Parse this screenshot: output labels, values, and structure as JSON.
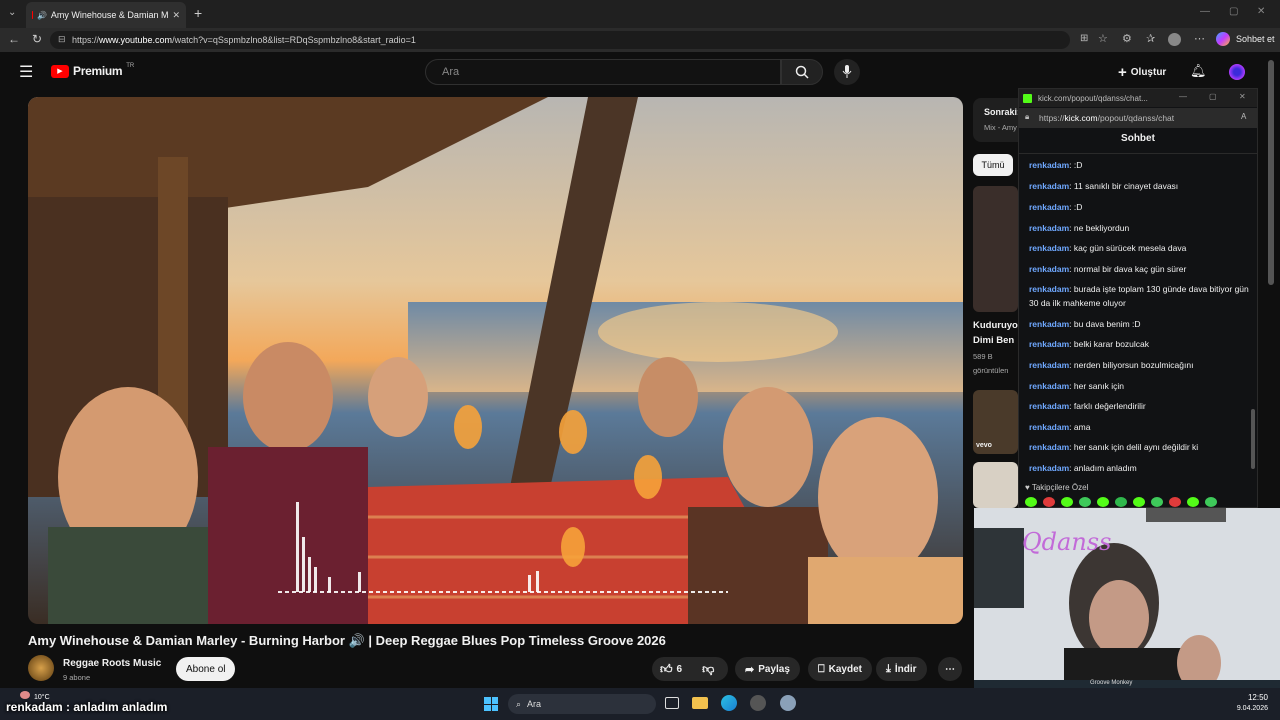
{
  "browser": {
    "tab_title": "Amy Winehouse & Damian M",
    "url_prefix": "https://",
    "url_domain": "www.youtube.com",
    "url_rest": "/watch?v=qSspmbzlno8&list=RDqSspmbzlno8&start_radio=1",
    "copilot_label": "Sohbet et"
  },
  "youtube": {
    "logo_text": "Premium",
    "logo_badge": "TR",
    "search_placeholder": "Ara",
    "create_label": "Oluştur",
    "video_title": "Amy Winehouse & Damian Marley - Burning Harbor 🔊 | Deep Reggae Blues Pop Timeless Groove 2026",
    "channel_name": "Reggae Roots Music",
    "subscribers": "9 abone",
    "subscribe_label": "Abone ol",
    "like_count": "6",
    "share_label": "Paylaş",
    "save_label": "Kaydet",
    "download_label": "İndir",
    "sidebar": {
      "next_label": "Sonraki:",
      "mix_label": "Mix - Amy",
      "all_chip": "Tümü",
      "rec_title_1": "Kuduruyo",
      "rec_title_2": "Dimi Ben",
      "rec_views": "589 B",
      "rec_views_2": "görüntülen",
      "vevo": "vevo"
    }
  },
  "chat": {
    "window_title": "kick.com/popout/qdanss/chat...",
    "url_prefix": "https://",
    "url_domain": "kick.com",
    "url_rest": "/popout/qdanss/chat",
    "header": "Sohbet",
    "followers_only": "Takipçilere Özel",
    "messages": [
      {
        "user": "renkadam",
        "text": ":D"
      },
      {
        "user": "renkadam",
        "text": "11 sanıklı bir cinayet davası"
      },
      {
        "user": "renkadam",
        "text": ":D"
      },
      {
        "user": "renkadam",
        "text": "ne bekliyordun"
      },
      {
        "user": "renkadam",
        "text": "kaç gün sürücek mesela dava"
      },
      {
        "user": "renkadam",
        "text": "normal bir dava kaç gün sürer"
      },
      {
        "user": "renkadam",
        "text": "burada işte toplam 130 günde dava bitiyor gün 30 da ilk mahkeme oluyor"
      },
      {
        "user": "renkadam",
        "text": "bu dava benim :D"
      },
      {
        "user": "renkadam",
        "text": "belki karar bozulcak"
      },
      {
        "user": "renkadam",
        "text": "nerden biliyorsun bozulmicağını"
      },
      {
        "user": "renkadam",
        "text": "her sanık için"
      },
      {
        "user": "renkadam",
        "text": "farklı değerlendirilir"
      },
      {
        "user": "renkadam",
        "text": "ama"
      },
      {
        "user": "renkadam",
        "text": "her sanık için delil aynı değildir ki"
      },
      {
        "user": "renkadam",
        "text": "anladım anladım"
      }
    ]
  },
  "webcam": {
    "watermark": "Qdanss",
    "caption": "Groove Monkey"
  },
  "overlay": {
    "user": "renkadam",
    "text": ": anladım anladım",
    "temperature": "10°C"
  },
  "taskbar": {
    "search_placeholder": "Ara",
    "time": "12:50",
    "date": "9.04.2026"
  },
  "colors": {
    "youtube_red": "#ff0000",
    "kick_green": "#53fc18",
    "chat_username": "#6fa8ff",
    "accent_blue": "#3ea6ff"
  }
}
